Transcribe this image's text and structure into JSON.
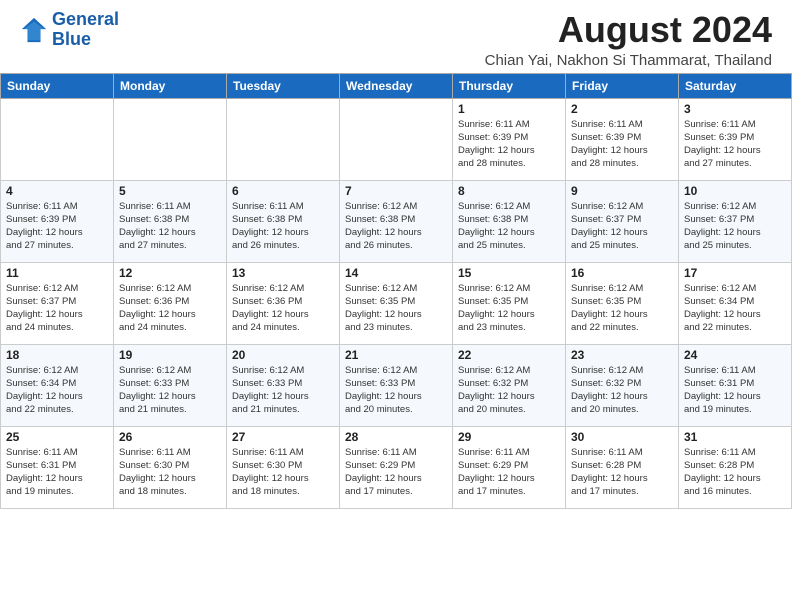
{
  "header": {
    "logo_line1": "General",
    "logo_line2": "Blue",
    "month_title": "August 2024",
    "location": "Chian Yai, Nakhon Si Thammarat, Thailand"
  },
  "days_of_week": [
    "Sunday",
    "Monday",
    "Tuesday",
    "Wednesday",
    "Thursday",
    "Friday",
    "Saturday"
  ],
  "weeks": [
    [
      {
        "day": "",
        "info": ""
      },
      {
        "day": "",
        "info": ""
      },
      {
        "day": "",
        "info": ""
      },
      {
        "day": "",
        "info": ""
      },
      {
        "day": "1",
        "info": "Sunrise: 6:11 AM\nSunset: 6:39 PM\nDaylight: 12 hours\nand 28 minutes."
      },
      {
        "day": "2",
        "info": "Sunrise: 6:11 AM\nSunset: 6:39 PM\nDaylight: 12 hours\nand 28 minutes."
      },
      {
        "day": "3",
        "info": "Sunrise: 6:11 AM\nSunset: 6:39 PM\nDaylight: 12 hours\nand 27 minutes."
      }
    ],
    [
      {
        "day": "4",
        "info": "Sunrise: 6:11 AM\nSunset: 6:39 PM\nDaylight: 12 hours\nand 27 minutes."
      },
      {
        "day": "5",
        "info": "Sunrise: 6:11 AM\nSunset: 6:38 PM\nDaylight: 12 hours\nand 27 minutes."
      },
      {
        "day": "6",
        "info": "Sunrise: 6:11 AM\nSunset: 6:38 PM\nDaylight: 12 hours\nand 26 minutes."
      },
      {
        "day": "7",
        "info": "Sunrise: 6:12 AM\nSunset: 6:38 PM\nDaylight: 12 hours\nand 26 minutes."
      },
      {
        "day": "8",
        "info": "Sunrise: 6:12 AM\nSunset: 6:38 PM\nDaylight: 12 hours\nand 25 minutes."
      },
      {
        "day": "9",
        "info": "Sunrise: 6:12 AM\nSunset: 6:37 PM\nDaylight: 12 hours\nand 25 minutes."
      },
      {
        "day": "10",
        "info": "Sunrise: 6:12 AM\nSunset: 6:37 PM\nDaylight: 12 hours\nand 25 minutes."
      }
    ],
    [
      {
        "day": "11",
        "info": "Sunrise: 6:12 AM\nSunset: 6:37 PM\nDaylight: 12 hours\nand 24 minutes."
      },
      {
        "day": "12",
        "info": "Sunrise: 6:12 AM\nSunset: 6:36 PM\nDaylight: 12 hours\nand 24 minutes."
      },
      {
        "day": "13",
        "info": "Sunrise: 6:12 AM\nSunset: 6:36 PM\nDaylight: 12 hours\nand 24 minutes."
      },
      {
        "day": "14",
        "info": "Sunrise: 6:12 AM\nSunset: 6:35 PM\nDaylight: 12 hours\nand 23 minutes."
      },
      {
        "day": "15",
        "info": "Sunrise: 6:12 AM\nSunset: 6:35 PM\nDaylight: 12 hours\nand 23 minutes."
      },
      {
        "day": "16",
        "info": "Sunrise: 6:12 AM\nSunset: 6:35 PM\nDaylight: 12 hours\nand 22 minutes."
      },
      {
        "day": "17",
        "info": "Sunrise: 6:12 AM\nSunset: 6:34 PM\nDaylight: 12 hours\nand 22 minutes."
      }
    ],
    [
      {
        "day": "18",
        "info": "Sunrise: 6:12 AM\nSunset: 6:34 PM\nDaylight: 12 hours\nand 22 minutes."
      },
      {
        "day": "19",
        "info": "Sunrise: 6:12 AM\nSunset: 6:33 PM\nDaylight: 12 hours\nand 21 minutes."
      },
      {
        "day": "20",
        "info": "Sunrise: 6:12 AM\nSunset: 6:33 PM\nDaylight: 12 hours\nand 21 minutes."
      },
      {
        "day": "21",
        "info": "Sunrise: 6:12 AM\nSunset: 6:33 PM\nDaylight: 12 hours\nand 20 minutes."
      },
      {
        "day": "22",
        "info": "Sunrise: 6:12 AM\nSunset: 6:32 PM\nDaylight: 12 hours\nand 20 minutes."
      },
      {
        "day": "23",
        "info": "Sunrise: 6:12 AM\nSunset: 6:32 PM\nDaylight: 12 hours\nand 20 minutes."
      },
      {
        "day": "24",
        "info": "Sunrise: 6:11 AM\nSunset: 6:31 PM\nDaylight: 12 hours\nand 19 minutes."
      }
    ],
    [
      {
        "day": "25",
        "info": "Sunrise: 6:11 AM\nSunset: 6:31 PM\nDaylight: 12 hours\nand 19 minutes."
      },
      {
        "day": "26",
        "info": "Sunrise: 6:11 AM\nSunset: 6:30 PM\nDaylight: 12 hours\nand 18 minutes."
      },
      {
        "day": "27",
        "info": "Sunrise: 6:11 AM\nSunset: 6:30 PM\nDaylight: 12 hours\nand 18 minutes."
      },
      {
        "day": "28",
        "info": "Sunrise: 6:11 AM\nSunset: 6:29 PM\nDaylight: 12 hours\nand 17 minutes."
      },
      {
        "day": "29",
        "info": "Sunrise: 6:11 AM\nSunset: 6:29 PM\nDaylight: 12 hours\nand 17 minutes."
      },
      {
        "day": "30",
        "info": "Sunrise: 6:11 AM\nSunset: 6:28 PM\nDaylight: 12 hours\nand 17 minutes."
      },
      {
        "day": "31",
        "info": "Sunrise: 6:11 AM\nSunset: 6:28 PM\nDaylight: 12 hours\nand 16 minutes."
      }
    ]
  ]
}
